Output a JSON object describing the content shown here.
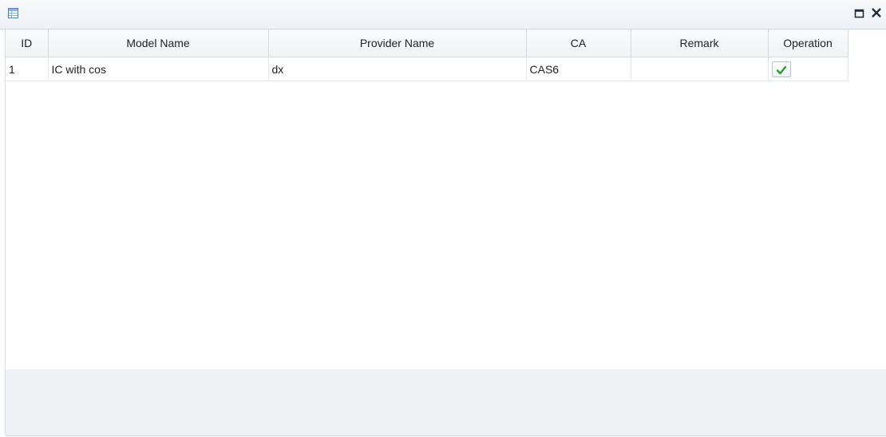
{
  "window": {
    "icons": {
      "title": "grid-window-icon",
      "maximize": "maximize-icon",
      "close": "close-icon"
    }
  },
  "grid": {
    "columns": {
      "id": "ID",
      "model_name": "Model Name",
      "provider_name": "Provider Name",
      "ca": "CA",
      "remark": "Remark",
      "operation": "Operation"
    },
    "rows": [
      {
        "id": "1",
        "model_name": "IC with cos",
        "provider_name": "dx",
        "ca": "CAS6",
        "remark": "",
        "operation_icon": "checkmark-icon"
      }
    ]
  },
  "colors": {
    "accent_check": "#2e9a2e",
    "title_icon_blue": "#4a86c5",
    "footer_bg": "#eef2f5"
  }
}
